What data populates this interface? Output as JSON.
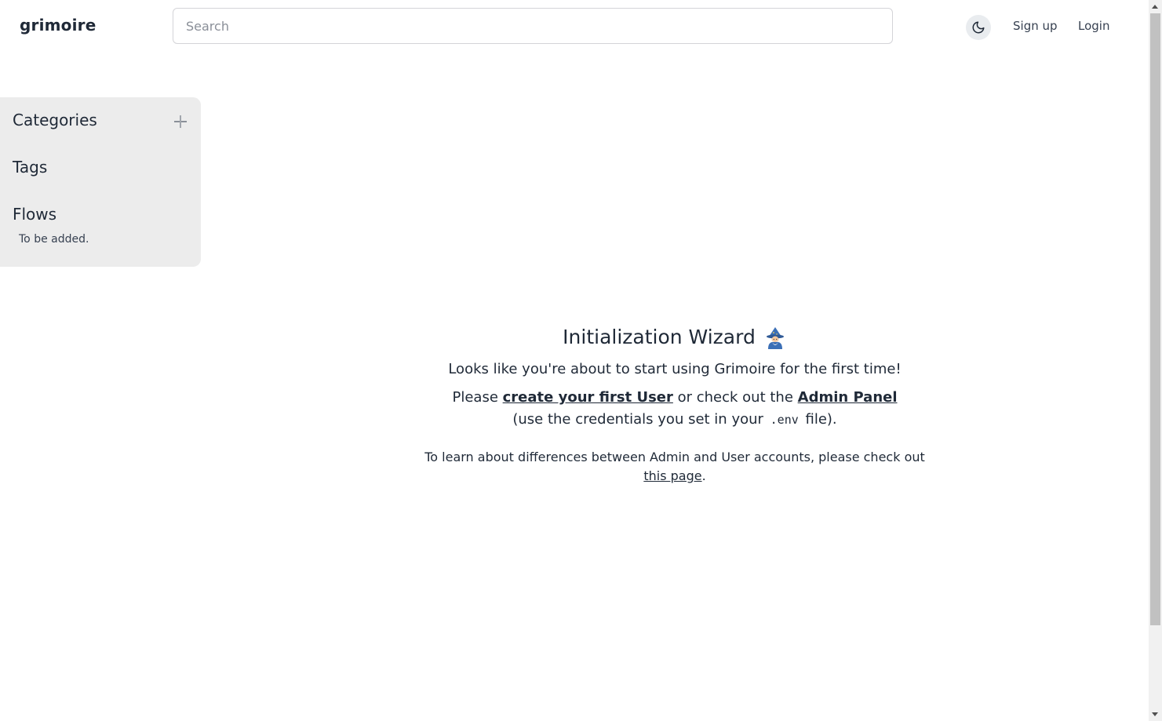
{
  "header": {
    "brand": "grimoire",
    "search_placeholder": "Search",
    "search_value": "",
    "theme_icon": "moon-icon",
    "signup_label": "Sign up",
    "login_label": "Login"
  },
  "sidebar": {
    "categories_label": "Categories",
    "add_icon": "plus-icon",
    "tags_label": "Tags",
    "flows_label": "Flows",
    "flows_note": "To be added."
  },
  "wizard": {
    "title": "Initialization Wizard",
    "title_icon": "mage-emoji-icon",
    "intro": "Looks like you're about to start using Grimoire for the first time!",
    "p2_before": "Please ",
    "create_user_link": "create your first User",
    "p2_middle": " or check out the ",
    "admin_panel_link": "Admin Panel",
    "p2_after_admin": " (use the credentials you set in your ",
    "env_code": ".env",
    "p2_end": " file).",
    "p3_before": "To learn about differences between Admin and User accounts, please check out ",
    "this_page_link": "this page",
    "p3_end": "."
  },
  "colors": {
    "sidebar_bg": "#ececec",
    "text": "#1f2937",
    "toggle_bg": "#e9ecef"
  }
}
